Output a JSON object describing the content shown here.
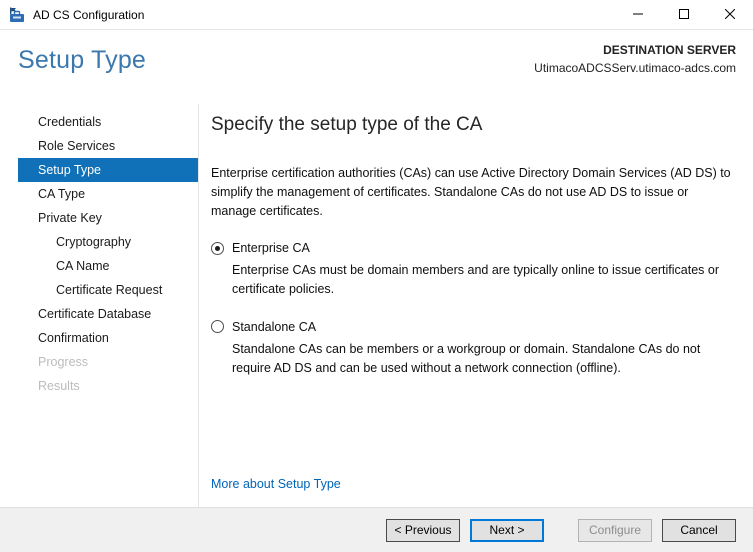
{
  "window": {
    "title": "AD CS Configuration"
  },
  "titlebar": {
    "icons": [
      "adcs-app-icon",
      "minimize-icon",
      "maximize-icon",
      "close-icon"
    ]
  },
  "header": {
    "page_title": "Setup Type",
    "destination_label": "DESTINATION SERVER",
    "destination_server": "UtimacoADCSServ.utimaco-adcs.com"
  },
  "sidebar": {
    "items": [
      {
        "label": "Credentials",
        "state": "normal",
        "indent": 0
      },
      {
        "label": "Role Services",
        "state": "normal",
        "indent": 0
      },
      {
        "label": "Setup Type",
        "state": "selected",
        "indent": 0
      },
      {
        "label": "CA Type",
        "state": "normal",
        "indent": 0
      },
      {
        "label": "Private Key",
        "state": "normal",
        "indent": 0
      },
      {
        "label": "Cryptography",
        "state": "normal",
        "indent": 1
      },
      {
        "label": "CA Name",
        "state": "normal",
        "indent": 1
      },
      {
        "label": "Certificate Request",
        "state": "normal",
        "indent": 1
      },
      {
        "label": "Certificate Database",
        "state": "normal",
        "indent": 0
      },
      {
        "label": "Confirmation",
        "state": "normal",
        "indent": 0
      },
      {
        "label": "Progress",
        "state": "disabled",
        "indent": 0
      },
      {
        "label": "Results",
        "state": "disabled",
        "indent": 0
      }
    ]
  },
  "content": {
    "heading": "Specify the setup type of the CA",
    "intro": "Enterprise certification authorities (CAs) can use Active Directory Domain Services (AD DS) to simplify the management of certificates. Standalone CAs do not use AD DS to issue or manage certificates.",
    "options": [
      {
        "label": "Enterprise CA",
        "selected": true,
        "description": "Enterprise CAs must be domain members and are typically online to issue certificates or certificate policies."
      },
      {
        "label": "Standalone CA",
        "selected": false,
        "description": "Standalone CAs can be members or a workgroup or domain. Standalone CAs do not require AD DS and can be used without a network connection (offline)."
      }
    ],
    "link": "More about Setup Type"
  },
  "footer": {
    "buttons": [
      {
        "label": "< Previous",
        "state": "normal"
      },
      {
        "label": "Next >",
        "state": "default"
      },
      {
        "label": "Configure",
        "state": "disabled"
      },
      {
        "label": "Cancel",
        "state": "normal"
      }
    ]
  },
  "colors": {
    "sidebar_selected_bg": "#1070b8",
    "page_title_blue": "#3b78ae",
    "link_blue": "#0064b6",
    "default_button_border": "#0078d7",
    "footer_bg": "#f0f0f0",
    "button_bg": "#e1e1e1"
  }
}
